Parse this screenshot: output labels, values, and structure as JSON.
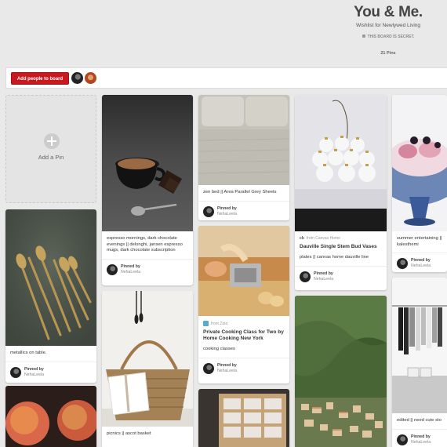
{
  "board": {
    "title": "You & Me.",
    "description": "Wishlist for Newlywed Living",
    "secret_notice": "THIS BOARD IS SECRET.",
    "pin_count": "21 Pins"
  },
  "collaborators": {
    "add_button_label": "Add people to board"
  },
  "add_pin_label": "Add a Pin",
  "pinned_by_label": "Pinned by",
  "pinner_name": "NehaLeela",
  "colors": {
    "accent_red": "#c8191e",
    "background": "#e9e9e9",
    "pin_background": "#ffffff"
  },
  "pins": [
    {
      "id": "metallics",
      "description": "metallics on table."
    },
    {
      "id": "peaches"
    },
    {
      "id": "espresso",
      "description": "espresso mornings, dark chocolate evenings || delonghi, jansen espresso mugs, dark chocolate subscription"
    },
    {
      "id": "picnics",
      "description": "picnics || ascot basket"
    },
    {
      "id": "zen-bed",
      "description": "zen bed || Area Parallel Grey Sheets"
    },
    {
      "id": "cooking-class",
      "source_site": "from Zola",
      "title": "Private Cooking Class for Two by Home Cooking New York",
      "description": "cooking classes"
    },
    {
      "id": "linen-box"
    },
    {
      "id": "dauville-vases",
      "source_brand": "cb",
      "source_site": "from Canvas Home",
      "title": "Dauville Single Stem Bud Vases",
      "description": "plates || canvas home dauville line"
    },
    {
      "id": "lake-como"
    },
    {
      "id": "summer-entertaining",
      "description": "summer entertaining || kalesthemi"
    },
    {
      "id": "closet",
      "description": "edited || need cute sto"
    }
  ]
}
